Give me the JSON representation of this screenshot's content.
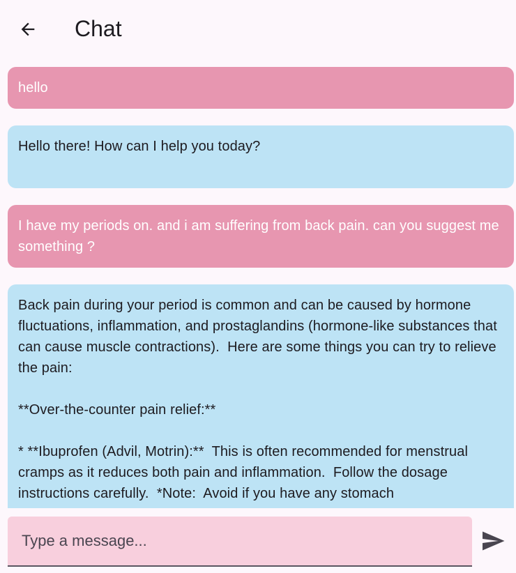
{
  "appbar": {
    "title": "Chat",
    "back_icon": "arrow-left-icon"
  },
  "messages": [
    {
      "role": "user",
      "text": "hello"
    },
    {
      "role": "bot",
      "text": "Hello there! How can I help you today?\n"
    },
    {
      "role": "user",
      "text": "I have my periods on. and i am suffering from back pain. can you suggest me something ?"
    },
    {
      "role": "bot",
      "text": "Back pain during your period is common and can be caused by hormone fluctuations, inflammation, and prostaglandins (hormone-like substances that can cause muscle contractions).  Here are some things you can try to relieve the pain:\n\n**Over-the-counter pain relief:**\n\n* **Ibuprofen (Advil, Motrin):**  This is often recommended for menstrual cramps as it reduces both pain and inflammation.  Follow the dosage instructions carefully.  *Note:  Avoid if you have any stomach"
    }
  ],
  "composer": {
    "placeholder": "Type a message...",
    "value": "",
    "send_icon": "send-icon"
  },
  "colors": {
    "background": "#fdf7fc",
    "user_bubble": "#e796b0",
    "bot_bubble": "#bde3f5",
    "input_fill": "#f8cfdd"
  }
}
